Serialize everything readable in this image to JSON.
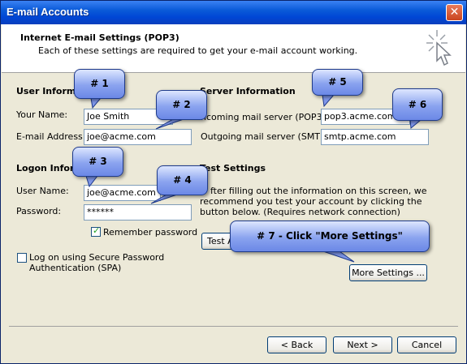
{
  "window": {
    "title": "E-mail Accounts",
    "close_glyph": "✕"
  },
  "header": {
    "title": "Internet E-mail Settings (POP3)",
    "subtitle": "Each of these settings are required to get your e-mail account working."
  },
  "user_info": {
    "heading": "User Informa",
    "name_label": "Your Name:",
    "name_value": "Joe Smith",
    "email_label": "E-mail Address:",
    "email_value": "joe@acme.com"
  },
  "logon_info": {
    "heading": "Logon Inform",
    "username_label": "User Name:",
    "username_value": "joe@acme.com",
    "password_label": "Password:",
    "password_value": "******",
    "remember_label": "Remember password",
    "spa_label_line1": "Log on using Secure Password",
    "spa_label_line2": "Authentication (SPA)"
  },
  "server_info": {
    "heading": "Server Information",
    "incoming_label": "ncoming mail server (POP3):",
    "incoming_value": "pop3.acme.com",
    "outgoing_label": "Outgoing mail server (SMTP):",
    "outgoing_value": "smtp.acme.com"
  },
  "test_settings": {
    "heading": "Test Settings",
    "line1": "fter filling out the information on this screen, we",
    "line2": "recommend you test your account by clicking the",
    "line3": "button below. (Requires network connection)",
    "test_button": "Test A",
    "more_settings_button": "More Settings ..."
  },
  "footer": {
    "back": "< Back",
    "next": "Next >",
    "cancel": "Cancel"
  },
  "callouts": [
    "# 1",
    "# 2",
    "# 3",
    "# 4",
    "# 5",
    "# 6",
    "# 7 - Click \"More Settings\""
  ],
  "colors": {
    "titlebar": "#0a5ad8",
    "callout": "#8aa3ef",
    "dialog_bg": "#ece9d8"
  }
}
